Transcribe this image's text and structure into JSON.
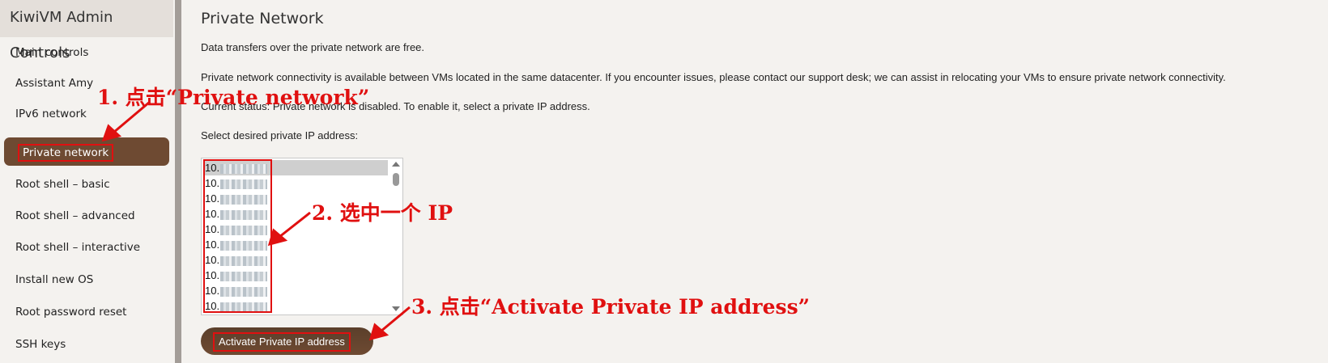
{
  "sidebar": {
    "title": "KiwiVM Admin Controls",
    "items": [
      {
        "label": "Main controls"
      },
      {
        "label": "Assistant Amy"
      },
      {
        "label": "IPv6 network"
      },
      {
        "label": "Private network",
        "active": true
      },
      {
        "label": "Root shell – basic"
      },
      {
        "label": "Root shell – advanced"
      },
      {
        "label": "Root shell – interactive"
      },
      {
        "label": "Install new OS"
      },
      {
        "label": "Root password reset"
      },
      {
        "label": "SSH keys"
      }
    ]
  },
  "main": {
    "title": "Private Network",
    "paragraphs": [
      "Data transfers over the private network are free.",
      "Private network connectivity is available between VMs located in the same datacenter. If you encounter issues, please contact our support desk; we can assist in relocating your VMs to ensure private network connectivity.",
      "Current status: Private network is disabled. To enable it, select a private IP address.",
      "Select desired private IP address:"
    ],
    "ip_list": {
      "items": [
        "10.",
        "10.",
        "10.",
        "10.",
        "10.",
        "10.",
        "10.",
        "10.",
        "10.",
        "10."
      ],
      "selected_index": 0
    },
    "activate_button": "Activate Private IP address"
  },
  "annotations": {
    "step1": "1. 点击“Private network”",
    "step2": "2. 选中一个 IP",
    "step3": "3. 点击“Activate Private IP address”"
  },
  "colors": {
    "accent_brown": "#6e4a32",
    "annotation_red": "#e01010",
    "sidebar_header_bg": "#e4dfda",
    "page_bg": "#f4f2ef"
  }
}
